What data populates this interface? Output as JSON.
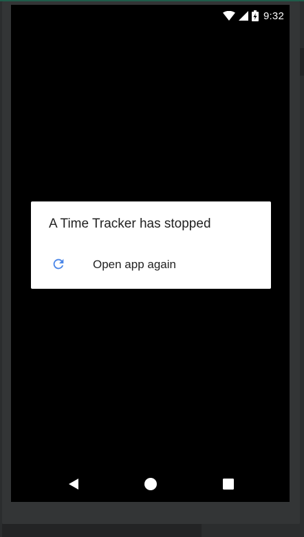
{
  "status_bar": {
    "time": "9:32",
    "icons": [
      "wifi-icon",
      "cell-signal-icon",
      "battery-charging-icon"
    ]
  },
  "dialog": {
    "title": "A Time Tracker has stopped",
    "action": {
      "label": "Open app again",
      "icon": "refresh-icon",
      "icon_color": "#4a86e8"
    }
  },
  "nav_bar": {
    "buttons": [
      "back-icon",
      "home-icon",
      "recents-icon"
    ],
    "color": "#ffffff"
  }
}
